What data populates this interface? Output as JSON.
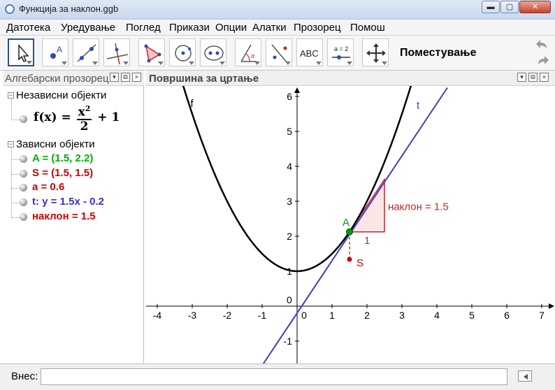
{
  "window": {
    "title": "Функција за наклон.ggb",
    "min_label": "▬",
    "max_label": "▢",
    "close_label": "✕"
  },
  "menu": [
    "Датотека",
    "Уредување",
    "Поглед",
    "Прикази",
    "Опции",
    "Алатки",
    "Прозорец",
    "Помош"
  ],
  "toolbar": {
    "mode_label": "Поместување",
    "text_tool_label": "ABC",
    "slider_tool_label": "a = 2"
  },
  "algebra": {
    "title": "Алгебарски прозорец",
    "free_header": "Независни објекти",
    "dependent_header": "Зависни објекти",
    "formula": {
      "lhs": "f(x) =",
      "num_base": "x",
      "num_exp": "2",
      "den": "2",
      "rhs": "+ 1"
    },
    "objects": [
      {
        "text": "A = (1.5, 2.2)",
        "color": "#00b000"
      },
      {
        "text": "S = (1.5, 1.5)",
        "color": "#cc0000"
      },
      {
        "text": "a = 0.6",
        "color": "#cc0000"
      },
      {
        "text": "t: y = 1.5x - 0.2",
        "color": "#3333cc"
      },
      {
        "text": "наклон = 1.5",
        "color": "#cc0000"
      }
    ]
  },
  "graphics": {
    "title": "Површина за цртање",
    "x_ticks": [
      "-4",
      "-3",
      "-2",
      "-1",
      "0",
      "1",
      "2",
      "3",
      "4",
      "5",
      "6",
      "7"
    ],
    "y_ticks": [
      "-1",
      "1",
      "2",
      "3",
      "4",
      "5",
      "6"
    ],
    "origin_label": "0",
    "labels": {
      "f": "f",
      "t": "t",
      "A": "A",
      "S": "S",
      "slope": "наклон = 1.5",
      "run": "1"
    },
    "colors": {
      "curve": "#000000",
      "tangent": "#3b3bd6",
      "point_A": "#00a000",
      "point_S": "#cc0000",
      "triangle": "#cc2222"
    }
  },
  "input": {
    "label": "Внес:",
    "value": ""
  }
}
